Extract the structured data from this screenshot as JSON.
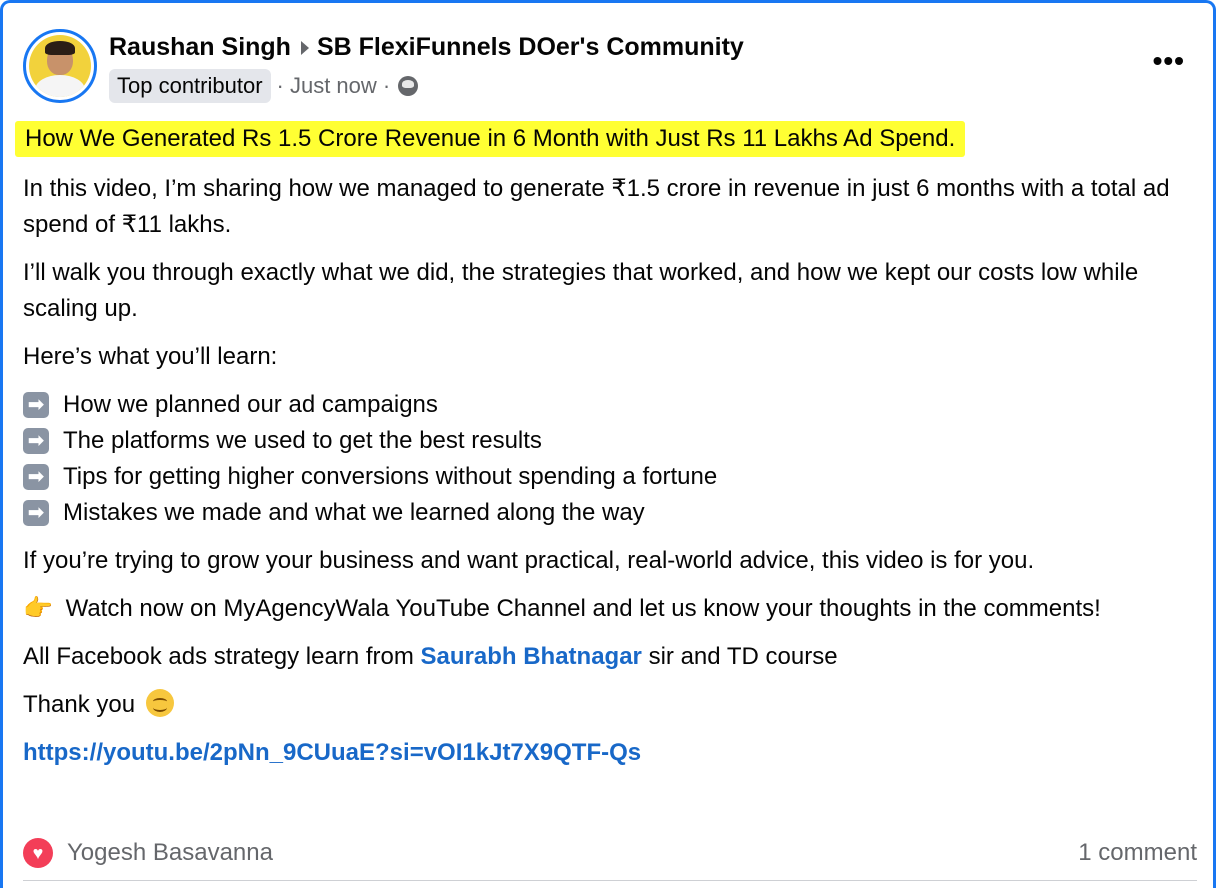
{
  "post": {
    "author": "Raushan Singh",
    "group": "SB FlexiFunnels DOer's Community",
    "badge": "Top contributor",
    "time": "· Just now ·",
    "more_label": "•••",
    "headline": "How We Generated Rs 1.5 Crore Revenue in 6 Month with Just Rs 11 Lakhs Ad Spend.",
    "paragraphs": [
      "In this video, I’m sharing how we managed to generate ₹1.5 crore in revenue in just 6 months with a total ad spend of ₹11 lakhs.",
      "I’ll walk you through exactly what we did, the strategies that worked, and how we kept our costs low while scaling up.",
      "Here’s what you’ll learn:"
    ],
    "list_items": [
      "How we planned our ad campaigns",
      "The platforms we used to get the best results",
      "Tips for getting higher conversions without spending a fortune",
      "Mistakes we made and what we learned along the way"
    ],
    "list_arrow": "➡",
    "grow_paragraph": "If you’re trying to grow your business and want practical, real-world advice, this video is for you.",
    "watch_emoji": "👉",
    "watch_paragraph": "Watch now on MyAgencyWala YouTube Channel and let us know your thoughts in the comments!",
    "strategy_before": "All Facebook ads strategy learn from",
    "strategy_link": "Saurabh Bhatnagar",
    "strategy_after": "sir and TD course",
    "thanks": "Thank you",
    "url": "https://youtu.be/2pNn_9CUuaE?si=vOI1kJt7X9QTF-Qs"
  },
  "footer": {
    "reaction_icon": "heart-icon",
    "reactor": "Yogesh Basavanna",
    "comments": "1 comment"
  },
  "colors": {
    "accent": "#1877f2",
    "highlight": "#ffff33",
    "link": "#1868c8",
    "heart": "#f33e58"
  }
}
